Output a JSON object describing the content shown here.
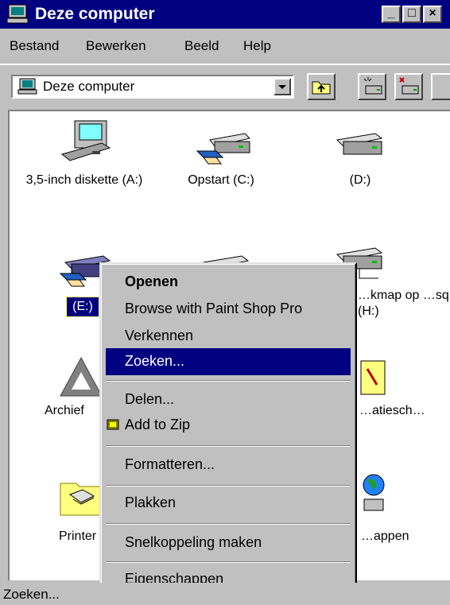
{
  "window": {
    "title": "Deze computer",
    "buttons": {
      "minimize": "_",
      "maximize": "□",
      "close": "×"
    }
  },
  "menubar": {
    "items": [
      "Bestand",
      "Bewerken",
      "Beeld",
      "Help"
    ]
  },
  "address": {
    "value": "Deze computer"
  },
  "drives": [
    {
      "label": "3,5-inch diskette (A:)",
      "icon": "floppy-drive-icon"
    },
    {
      "label": "Opstart (C:)",
      "icon": "shared-hard-drive-icon"
    },
    {
      "label": "(D:)",
      "icon": "hard-drive-icon"
    },
    {
      "label": "(E:)",
      "icon": "shared-removable-drive-icon"
    },
    {
      "label": "…kmap op …sq (H:)",
      "icon": "network-drive-icon"
    },
    {
      "label": "Archief",
      "icon": "archive-icon"
    },
    {
      "label": "…atiesch…",
      "icon": "control-panel-icon"
    },
    {
      "label": "Printer",
      "icon": "printers-folder-icon"
    },
    {
      "label": "…appen",
      "icon": "network-icon"
    }
  ],
  "context_menu": {
    "items": [
      {
        "label": "Openen",
        "bold": true
      },
      {
        "label": "Browse with Paint Shop Pro"
      },
      {
        "label": "Verkennen"
      },
      {
        "label": "Zoeken...",
        "selected": true
      },
      {
        "label": "Delen..."
      },
      {
        "label": "Add to Zip"
      },
      {
        "label": "Formatteren..."
      },
      {
        "label": "Plakken"
      },
      {
        "label": "Snelkoppeling maken"
      },
      {
        "label": "Eigenschappen"
      }
    ]
  },
  "statusbar": {
    "text": "Zoeken..."
  },
  "colors": {
    "titlebar": "#000080",
    "selection": "#000080",
    "face": "#c0c0c0"
  }
}
